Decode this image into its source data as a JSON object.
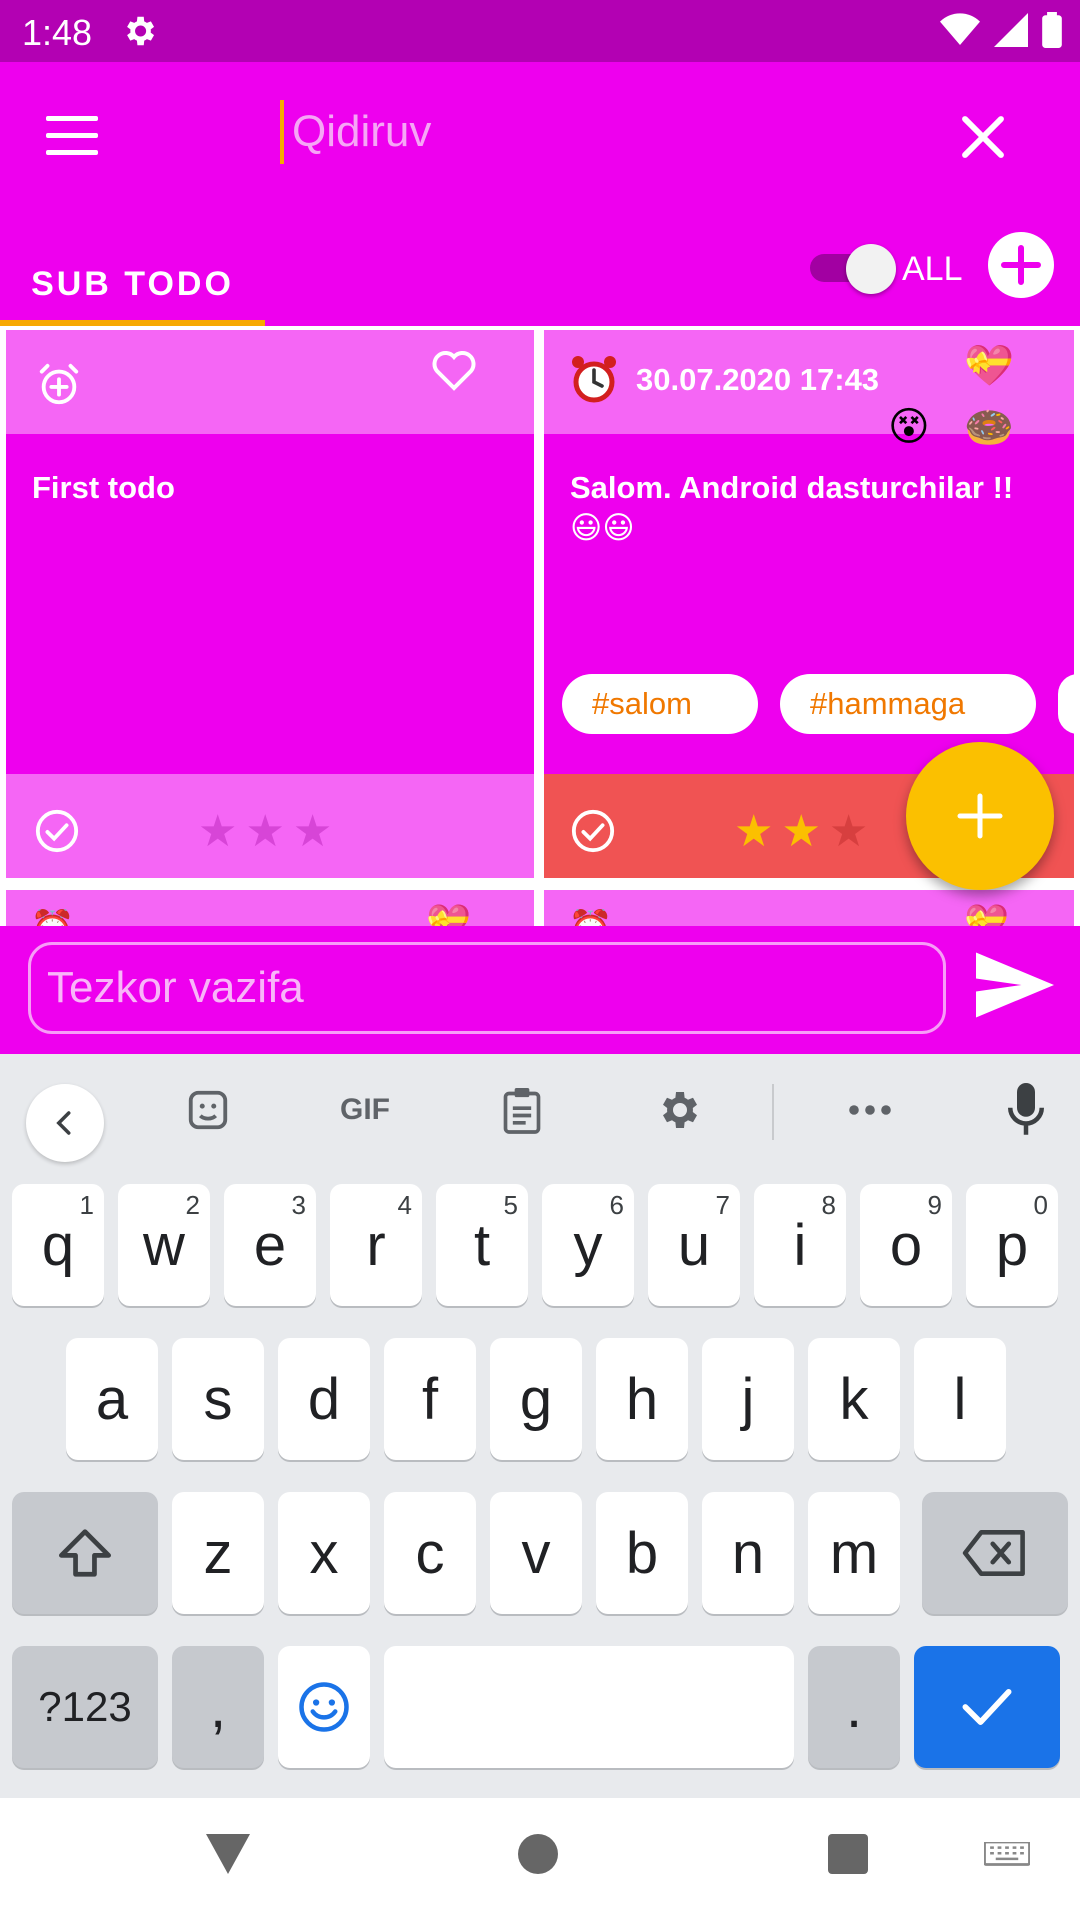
{
  "status_bar": {
    "time": "1:48"
  },
  "app_bar": {
    "search_placeholder": "Qidiruv",
    "tab_label": "SUB TODO",
    "toggle_label": "ALL"
  },
  "colors": {
    "primary": "#ee00ee",
    "primary_dark": "#b301b3",
    "accent": "#f7a900",
    "card_header": "#f566f5",
    "card_footer_alert": "#f05353",
    "fab": "#fbc000",
    "tag_text": "#f07800"
  },
  "cards": [
    {
      "title": "First todo",
      "reminder": "",
      "favorite": false,
      "rating": 0,
      "tags": []
    },
    {
      "title": "Salom. Android dasturchilar !! 😃😃",
      "reminder": "30.07.2020 17:43",
      "favorite": true,
      "rating": 2,
      "tags": [
        "#salom",
        "#hammaga"
      ]
    }
  ],
  "quick_task": {
    "placeholder": "Tezkor vazifa"
  },
  "keyboard": {
    "toolbar": {
      "gif_label": "GIF"
    },
    "row1": [
      "q",
      "w",
      "e",
      "r",
      "t",
      "y",
      "u",
      "i",
      "o",
      "p"
    ],
    "row1_hints": [
      "1",
      "2",
      "3",
      "4",
      "5",
      "6",
      "7",
      "8",
      "9",
      "0"
    ],
    "row2": [
      "a",
      "s",
      "d",
      "f",
      "g",
      "h",
      "j",
      "k",
      "l"
    ],
    "row3": [
      "z",
      "x",
      "c",
      "v",
      "b",
      "n",
      "m"
    ],
    "symbols_label": "?123",
    "comma": ",",
    "period": "."
  },
  "icons": {
    "menu": "hamburger-icon",
    "clear": "close-icon",
    "add": "plus-icon",
    "alarm_add": "alarm-add-icon",
    "alarm": "alarm-clock-icon",
    "heart": "heart-icon",
    "check": "check-circle-icon",
    "star": "star-icon",
    "send": "send-icon"
  }
}
